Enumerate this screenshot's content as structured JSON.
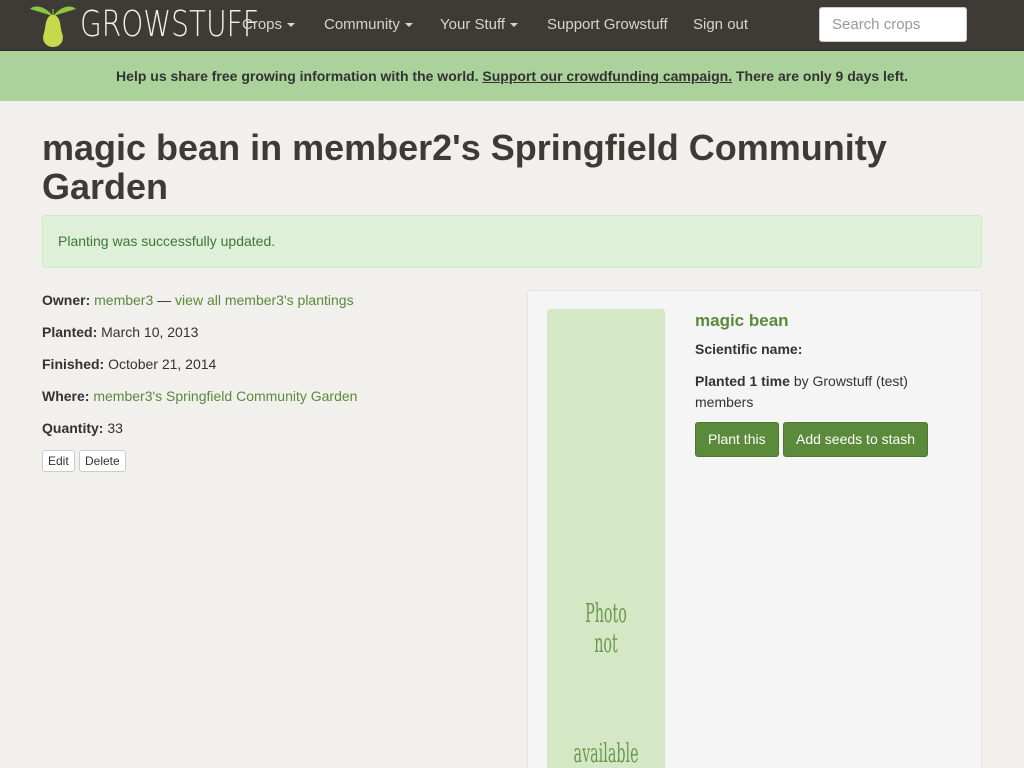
{
  "nav": {
    "brand": "GROWSTUFF",
    "items": [
      {
        "label": "Crops",
        "dropdown": true
      },
      {
        "label": "Community",
        "dropdown": true
      },
      {
        "label": "Your Stuff",
        "dropdown": true
      },
      {
        "label": "Support Growstuff",
        "dropdown": false
      },
      {
        "label": "Sign out",
        "dropdown": false
      }
    ],
    "search_placeholder": "Search crops"
  },
  "banner": {
    "text_before": "Help us share free growing information with the world.",
    "link": "Support our crowdfunding campaign.",
    "text_after": "There are only 9 days left."
  },
  "page_title": "magic bean in member2's Springfield Community Garden",
  "alert": "Planting was successfully updated.",
  "details": {
    "owner_label": "Owner:",
    "owner": "member3",
    "dash": "—",
    "view_all": "view all member3's plantings",
    "planted_label": "Planted:",
    "planted": "March 10, 2013",
    "finished_label": "Finished:",
    "finished": "October 21, 2014",
    "where_label": "Where:",
    "where": "member3's Springfield Community Garden",
    "quantity_label": "Quantity:",
    "quantity": "33",
    "edit": "Edit",
    "delete": "Delete"
  },
  "crop_card": {
    "photo_line1": "Photo not",
    "photo_line2": "available",
    "name": "magic bean",
    "scientific_label": "Scientific name:",
    "planted_prefix": "Planted 1 time",
    "planted_suffix": "by Growstuff (test) members",
    "plant_button": "Plant this",
    "stash_button": "Add seeds to stash"
  },
  "colors": {
    "navbar": "#3e3b37",
    "banner": "#abd29a",
    "accent_green": "#5a8a3a",
    "alert_bg": "#dff0d8"
  }
}
